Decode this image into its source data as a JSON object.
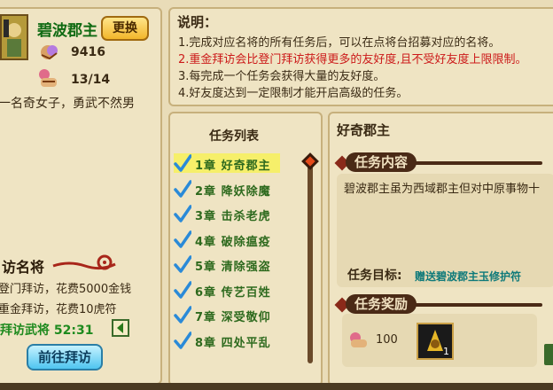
{
  "character": {
    "name": "碧波郡主",
    "change_button": "更换",
    "reputation": "9416",
    "friendship": "13/14",
    "description": "一名奇女子，勇武不然男"
  },
  "notes": {
    "title": "说明：",
    "lines": [
      "1.完成对应名将的所有任务后，可以在点将台招募对应的名将。",
      "2.重金拜访会比登门拜访获得更多的友好度,且不受好友度上限限制。",
      "3.每完成一个任务会获得大量的友好度。",
      "4.好友度达到一定限制才能开启高级的任务。"
    ],
    "highlight_color": "#cc1a1a"
  },
  "visit": {
    "title": "访名将",
    "door_visit": "登门拜访，花费5000金钱",
    "gold_visit": "重金拜访，花费10虎符",
    "timer": "拜访武将 52:31",
    "go_button": "前往拜访"
  },
  "task_list": {
    "title": "任务列表",
    "items": [
      {
        "chapter": "1章",
        "name": "好奇郡主",
        "selected": true
      },
      {
        "chapter": "2章",
        "name": "降妖除魔"
      },
      {
        "chapter": "3章",
        "name": "击杀老虎"
      },
      {
        "chapter": "4章",
        "name": "破除瘟疫"
      },
      {
        "chapter": "5章",
        "name": "清除强盗"
      },
      {
        "chapter": "6章",
        "name": "传艺百姓"
      },
      {
        "chapter": "7章",
        "name": "深受敬仰"
      },
      {
        "chapter": "8章",
        "name": "四处平乱"
      }
    ]
  },
  "task_detail": {
    "title": "好奇郡主",
    "content_header": "任务内容",
    "content": "碧波郡主虽为西域郡主但对中原事物十",
    "goal_label": "任务目标:",
    "goal_value": "赠送碧波郡主玉修护符",
    "reward_header": "任务奖励",
    "reward_amount": "100",
    "reward_item_count": "1"
  },
  "colors": {
    "goal_color": "#0f7a7a",
    "task_green": "#2e6a1e",
    "timer_green": "#1e8a1e"
  }
}
